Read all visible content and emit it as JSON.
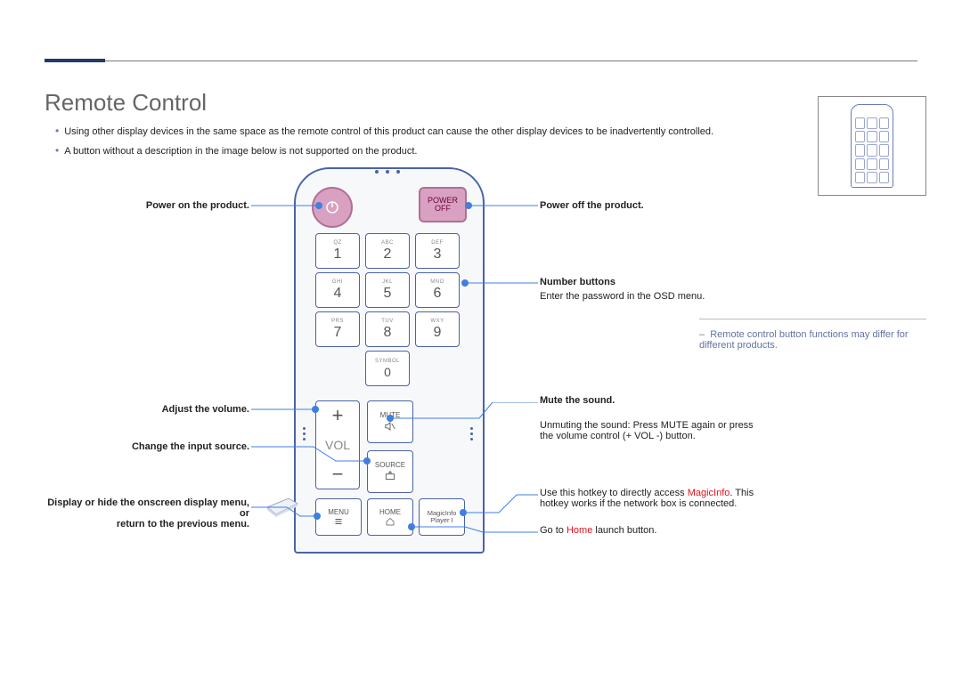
{
  "title": "Remote Control",
  "bullets": [
    "Using other display devices in the same space as the remote control of this product can cause the other display devices to be inadvertently controlled.",
    "A button without a description in the image below is not supported on the product."
  ],
  "note": "Remote control button functions may differ for different products.",
  "left": {
    "power_on": "Power on the product.",
    "adjust_volume": "Adjust the volume.",
    "change_source": "Change the input source.",
    "menu": "Display or hide the onscreen display menu, or\nreturn to the previous menu."
  },
  "right": {
    "power_off": "Power off the product.",
    "numbers_title": "Number buttons",
    "numbers_desc": "Enter the password in the OSD menu.",
    "mute_title": "Mute the sound.",
    "mute_desc_before": "Unmuting the sound: Press ",
    "mute_token": "MUTE",
    "mute_desc_after": " again or press\nthe volume control (+ VOL -) button.",
    "magicinfo_before": "Use this hotkey to directly access ",
    "magicinfo_token": "MagicInfo",
    "magicinfo_after": ". This\nhotkey works if the network box is connected.",
    "home_before": "Go to ",
    "home_token": "Home",
    "home_after": " launch button."
  },
  "remote": {
    "poweroff_label": "POWER\nOFF",
    "keys": [
      {
        "abc": "QZ",
        "num": "1"
      },
      {
        "abc": "ABC",
        "num": "2"
      },
      {
        "abc": "DEF",
        "num": "3"
      },
      {
        "abc": "GHI",
        "num": "4"
      },
      {
        "abc": "JKL",
        "num": "5"
      },
      {
        "abc": "MNO",
        "num": "6"
      },
      {
        "abc": "PRS",
        "num": "7"
      },
      {
        "abc": "TUV",
        "num": "8"
      },
      {
        "abc": "WXY",
        "num": "9"
      }
    ],
    "symbol_abc": "SYMBOL",
    "symbol_num": "0",
    "vol": "VOL",
    "mute": "MUTE",
    "source": "SOURCE",
    "menu": "MENU",
    "home": "HOME",
    "magicinfo_btn": "MagicInfo\nPlayer I"
  }
}
